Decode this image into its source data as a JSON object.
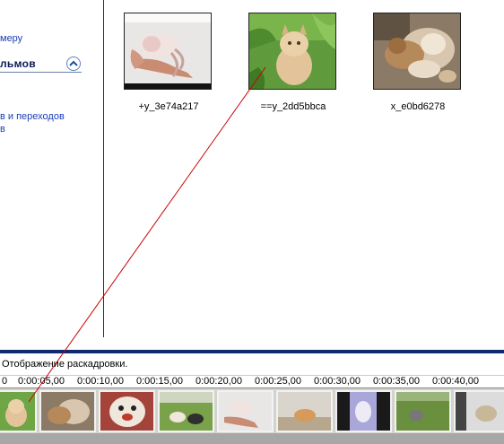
{
  "task_pane": {
    "link_camera": "меру",
    "section_title": "льмов",
    "link_effects": "в и переходов",
    "link_fragment": "в"
  },
  "collection": {
    "clips": [
      {
        "label": "+y_3e74a217",
        "icon": "kitten-in-hand-thumbnail"
      },
      {
        "label": "==y_2dd5bbca",
        "icon": "persian-cat-in-grass-thumbnail"
      },
      {
        "label": "x_e0bd6278",
        "icon": "sleeping-cats-thumbnail"
      }
    ]
  },
  "storyboard": {
    "status_text": "Отображение раскадровки.",
    "ruler_ticks": [
      "0",
      "0:00:05,00",
      "0:00:10,00",
      "0:00:15,00",
      "0:00:20,00",
      "0:00:25,00",
      "0:00:30,00",
      "0:00:35,00",
      "0:00:40,00"
    ],
    "frames": [
      "cat-in-grass",
      "two-cats",
      "cat-close-up",
      "cats-on-lawn",
      "kitten-in-hand",
      "cat-on-floor",
      "cat-on-bed",
      "cat-in-field",
      "cat-at-window"
    ]
  },
  "colors": {
    "link": "#1a3fb3",
    "divider": "#0d2a6e",
    "drag_line": "#cc0000"
  }
}
